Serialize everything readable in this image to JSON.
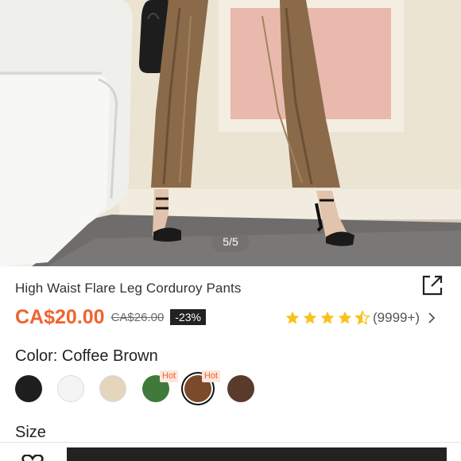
{
  "gallery": {
    "pager": "5/5"
  },
  "product": {
    "title": "High Waist Flare Leg Corduroy Pants",
    "price": "CA$20.00",
    "original_price": "CA$26.00",
    "discount": "-23%",
    "rating_count": "(9999+)",
    "rating_stars": 4.5
  },
  "color": {
    "label": "Color: Coffee Brown",
    "swatches": [
      {
        "name": "Black",
        "hex": "#1e1e1e",
        "hot": false
      },
      {
        "name": "White",
        "hex": "#f4f4f4",
        "hot": false
      },
      {
        "name": "Beige",
        "hex": "#e3d6bd",
        "hot": false
      },
      {
        "name": "Green",
        "hex": "#3f7a3a",
        "hot": true
      },
      {
        "name": "Coffee Brown",
        "hex": "#7b4a2a",
        "hot": true,
        "selected": true
      },
      {
        "name": "Dark Brown",
        "hex": "#5a3a2a",
        "hot": false
      }
    ],
    "hot_label": "Hot"
  },
  "size": {
    "label": "Size"
  },
  "colors": {
    "accent": "#f0632f",
    "star": "#f7c21b",
    "dark": "#222222"
  }
}
